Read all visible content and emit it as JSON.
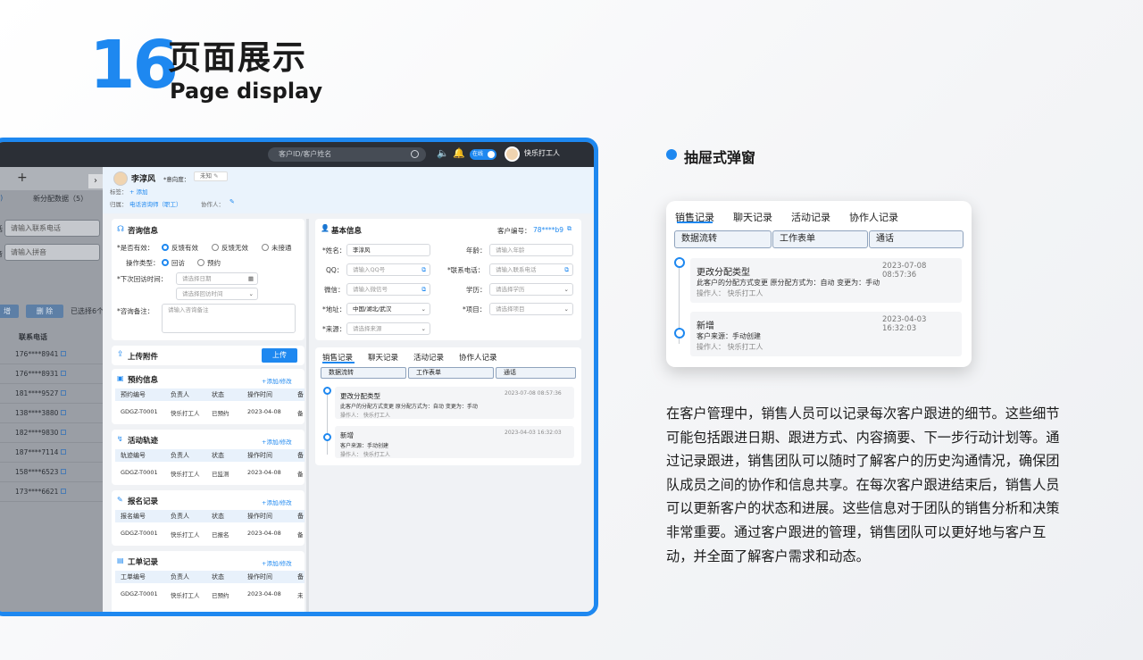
{
  "header": {
    "number": "16",
    "title_cn": "页面展示",
    "title_en": "Page display"
  },
  "app": {
    "search_placeholder": "客户ID/客户姓名",
    "online_label": "在线",
    "user_name": "快乐打工人",
    "left_panel": {
      "tab_plus": "+",
      "tab_partial": "1)",
      "sub_tab": "新分配数据（5）",
      "phone_placeholder": "请输入联系电话",
      "pinyin_placeholder": "请输入拼音",
      "label_phone_partial": "话",
      "label_pinyin_partial": "音",
      "btn_add_partial": "增",
      "btn_delete": "删 除",
      "selected_text": "已选择6个",
      "column_header": "联系电话",
      "rows": [
        "176****8941",
        "176****8931",
        "181****9527",
        "138****3880",
        "182****9830",
        "187****7114",
        "158****6523",
        "173****6621"
      ]
    },
    "drawer": {
      "customer_name": "李淳风",
      "intent_label": "*意向度：",
      "intent_value": "未知",
      "tag_label": "标签：",
      "tag_add": "+ 添加",
      "owner_label": "归属：",
      "owner_value": "电话咨询师（职工）",
      "collab_label": "协作人：",
      "consult": {
        "title": "咨询信息",
        "valid_label": "*是否有效：",
        "valid_options": [
          "反馈有效",
          "反馈无效",
          "未接通"
        ],
        "op_type_label": "操作类型：",
        "op_type_options": [
          "回访",
          "预约"
        ],
        "next_visit_label": "*下次回访时间：",
        "date_placeholder": "请选择日期",
        "time_placeholder": "请选择回访时间",
        "remark_label": "*咨询备注：",
        "remark_placeholder": "请输入咨询备注"
      },
      "attachment": {
        "title": "上传附件",
        "upload_button": "上传"
      },
      "appointment": {
        "title": "预约信息",
        "action": "+添加/修改",
        "headers": [
          "预约编号",
          "负责人",
          "状态",
          "操作时间",
          "备"
        ],
        "row": [
          "GDGZ-T0001",
          "快乐打工人",
          "已预约",
          "2023-04-08",
          "备"
        ]
      },
      "activity": {
        "title": "活动轨迹",
        "action": "+添加/修改",
        "headers": [
          "轨迹编号",
          "负责人",
          "状态",
          "操作时间",
          "备"
        ],
        "row": [
          "GDGZ-T0001",
          "快乐打工人",
          "已监测",
          "2023-04-08",
          "备"
        ]
      },
      "signup": {
        "title": "报名记录",
        "action": "+添加/修改",
        "headers": [
          "报名编号",
          "负责人",
          "状态",
          "操作时间",
          "备"
        ],
        "row": [
          "GDGZ-T0001",
          "快乐打工人",
          "已报名",
          "2023-04-08",
          "备"
        ]
      },
      "workorder": {
        "title": "工单记录",
        "action": "+添加/修改",
        "headers": [
          "工单编号",
          "负责人",
          "状态",
          "操作时间",
          "备"
        ],
        "row": [
          "GDGZ-T0001",
          "快乐打工人",
          "已预约",
          "2023-04-08",
          "未"
        ]
      },
      "basic": {
        "title": "基本信息",
        "customer_no_label": "客户编号：",
        "customer_no": "78****b9",
        "name_label": "*姓名：",
        "name_value": "李淳风",
        "age_label": "年龄：",
        "age_placeholder": "请输入年龄",
        "qq_label": "QQ：",
        "qq_placeholder": "请输入QQ号",
        "phone_label": "*联系电话：",
        "phone_placeholder": "请输入联系电话",
        "wechat_label": "微信：",
        "wechat_placeholder": "请输入微信号",
        "edu_label": "学历：",
        "edu_placeholder": "请选择学历",
        "addr_label": "*地址：",
        "addr_value": "中国/湖北/武汉",
        "project_label": "*项目：",
        "project_placeholder": "请选择项目",
        "source_label": "*来源：",
        "source_placeholder": "请选择来源"
      }
    }
  },
  "records": {
    "tabs": [
      "销售记录",
      "聊天记录",
      "活动记录",
      "协作人记录"
    ],
    "chips": [
      "数据流转",
      "工作表单",
      "通话"
    ],
    "items": [
      {
        "title": "更改分配类型",
        "time": "2023-07-08   08:57:36",
        "detail": "此客户的分配方式变更   原分配方式为：自动   变更为：手动",
        "operator": "操作人：  快乐打工人"
      },
      {
        "title": "新增",
        "time": "2023-04-03   16:32:03",
        "detail": "客户来源：手动创建",
        "operator": "操作人：  快乐打工人"
      }
    ]
  },
  "section_heading": "抽屉式弹窗",
  "description": "在客户管理中，销售人员可以记录每次客户跟进的细节。这些细节可能包括跟进日期、跟进方式、内容摘要、下一步行动计划等。通过记录跟进，销售团队可以随时了解客户的历史沟通情况，确保团队成员之间的协作和信息共享。在每次客户跟进结束后，销售人员可以更新客户的状态和进展。这些信息对于团队的销售分析和决策非常重要。通过客户跟进的管理，销售团队可以更好地与客户互动，并全面了解客户需求和动态。",
  "colors": {
    "accent": "#1e88f0",
    "dark_bar": "#2b2f36"
  }
}
